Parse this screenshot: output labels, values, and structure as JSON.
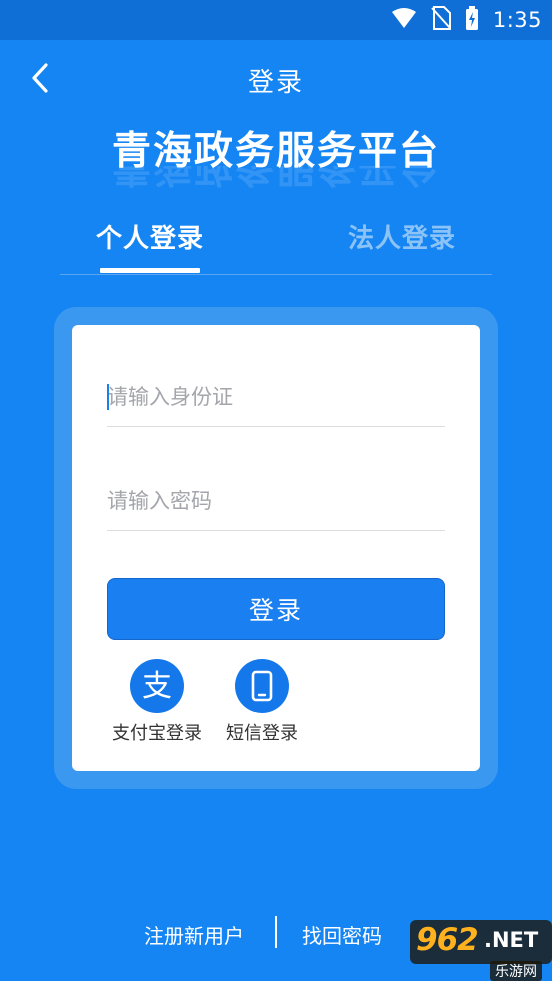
{
  "status_bar": {
    "time": "1:35"
  },
  "header": {
    "title": "登录"
  },
  "app": {
    "title": "青海政务服务平台"
  },
  "tabs": [
    {
      "label": "个人登录",
      "active": true
    },
    {
      "label": "法人登录",
      "active": false
    }
  ],
  "form": {
    "id_placeholder": "请输入身份证",
    "password_placeholder": "请输入密码",
    "submit_label": "登录"
  },
  "alt_login": {
    "alipay_label": "支付宝登录",
    "alipay_glyph": "支",
    "sms_label": "短信登录"
  },
  "footer": {
    "register_label": "注册新用户",
    "forgot_label": "找回密码"
  },
  "watermark": {
    "number": "962",
    "suffix": ".NET",
    "caption": "乐游网"
  },
  "colors": {
    "background": "#1585f3",
    "status_bar": "#0f6fd6",
    "primary_button": "#1a7ff0",
    "tab_inactive": "#8cc3f7"
  }
}
